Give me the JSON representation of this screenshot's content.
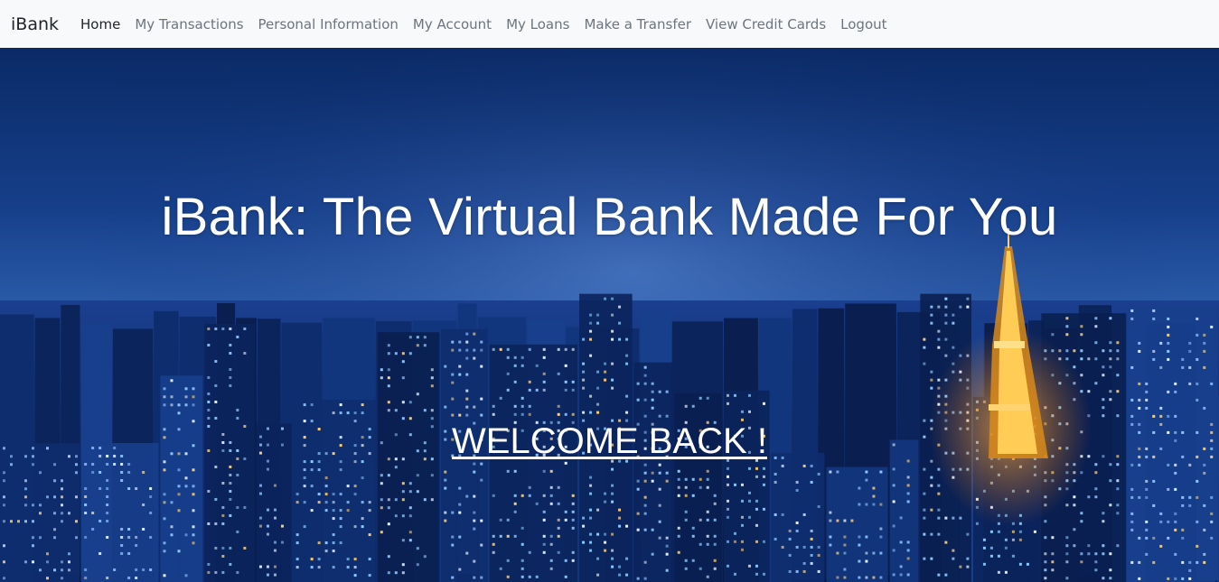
{
  "navbar": {
    "brand": "iBank",
    "items": [
      {
        "label": "Home",
        "active": true
      },
      {
        "label": "My Transactions"
      },
      {
        "label": "Personal Information"
      },
      {
        "label": "My Account"
      },
      {
        "label": "My Loans"
      },
      {
        "label": "Make a Transfer"
      },
      {
        "label": "View Credit Cards"
      },
      {
        "label": "Logout"
      }
    ]
  },
  "hero": {
    "title": "iBank: The Virtual Bank Made For You",
    "welcome_link": "WELCOME BACK !",
    "background": "night-city-skyline-image"
  },
  "colors": {
    "navbar_bg": "#f8f9fa",
    "nav_active": "#212529",
    "nav_inactive": "#6c757d",
    "hero_text": "#ffffff"
  }
}
